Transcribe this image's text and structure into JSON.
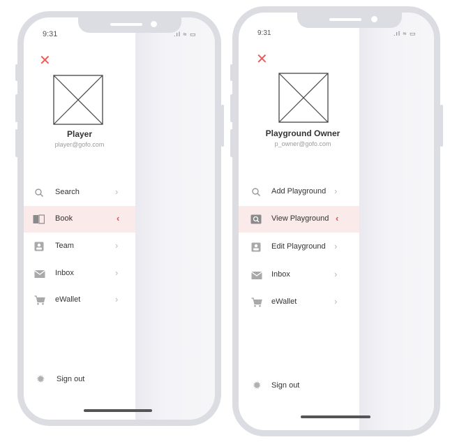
{
  "left": {
    "time": "9:31",
    "status_icons": ".ıl ≈ ▭",
    "name": "Player",
    "email": "player@gofo.com",
    "menu": [
      {
        "label": "Search",
        "icon": "search-icon"
      },
      {
        "label": "Book",
        "icon": "book-icon"
      },
      {
        "label": "Team",
        "icon": "team-icon"
      },
      {
        "label": "Inbox",
        "icon": "inbox-icon"
      },
      {
        "label": "eWallet",
        "icon": "cart-icon"
      }
    ],
    "active_index": 1,
    "signout": "Sign out"
  },
  "right": {
    "time": "9:31",
    "status_icons": ".ıl ≈ ▭",
    "name": "Playground Owner",
    "email": "p_owner@gofo.com",
    "menu": [
      {
        "label": "Add Playground",
        "icon": "search-icon"
      },
      {
        "label": "View Playground",
        "icon": "view-icon"
      },
      {
        "label": "Edit Playground",
        "icon": "edit-icon"
      },
      {
        "label": "Inbox",
        "icon": "inbox-icon"
      },
      {
        "label": "eWallet",
        "icon": "cart-icon"
      }
    ],
    "active_index": 1,
    "signout": "Sign out"
  },
  "colors": {
    "accent": "#ec5a5a",
    "frame": "#dcdde2",
    "active_bg": "#fbeaea"
  },
  "glyphs": {
    "close": "✕",
    "chevron": "›",
    "chevron_active": "‹"
  }
}
